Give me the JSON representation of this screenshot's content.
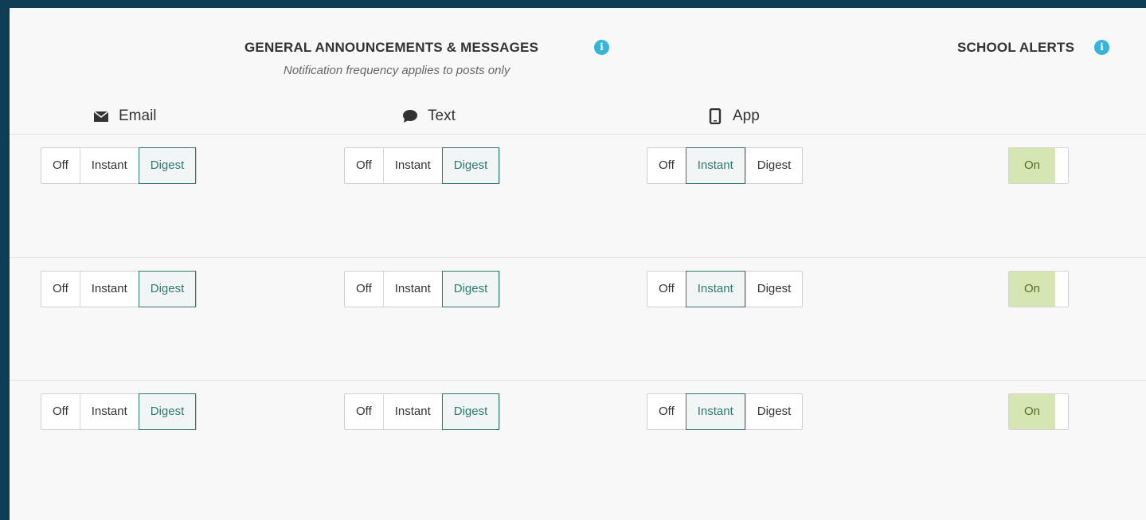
{
  "headers": {
    "general_title": "GENERAL ANNOUNCEMENTS & MESSAGES",
    "general_subtitle": "Notification frequency applies to posts only",
    "school_alerts_title": "SCHOOL ALERTS",
    "info_icon": "i"
  },
  "channels": [
    {
      "label": "Email",
      "icon": "envelope-icon"
    },
    {
      "label": "Text",
      "icon": "speech-bubble-icon"
    },
    {
      "label": "App",
      "icon": "phone-icon"
    }
  ],
  "options": [
    "Off",
    "Instant",
    "Digest"
  ],
  "rows": [
    {
      "email": "Digest",
      "text": "Digest",
      "app": "Instant",
      "school_alerts": "On"
    },
    {
      "email": "Digest",
      "text": "Digest",
      "app": "Instant",
      "school_alerts": "On"
    },
    {
      "email": "Digest",
      "text": "Digest",
      "app": "Instant",
      "school_alerts": "On"
    }
  ],
  "colors": {
    "frame": "#0f3d55",
    "panel": "#f8f8f8",
    "selected_border": "#2d7970",
    "toggle_on": "#d6e6b2",
    "info": "#36b4d9"
  }
}
